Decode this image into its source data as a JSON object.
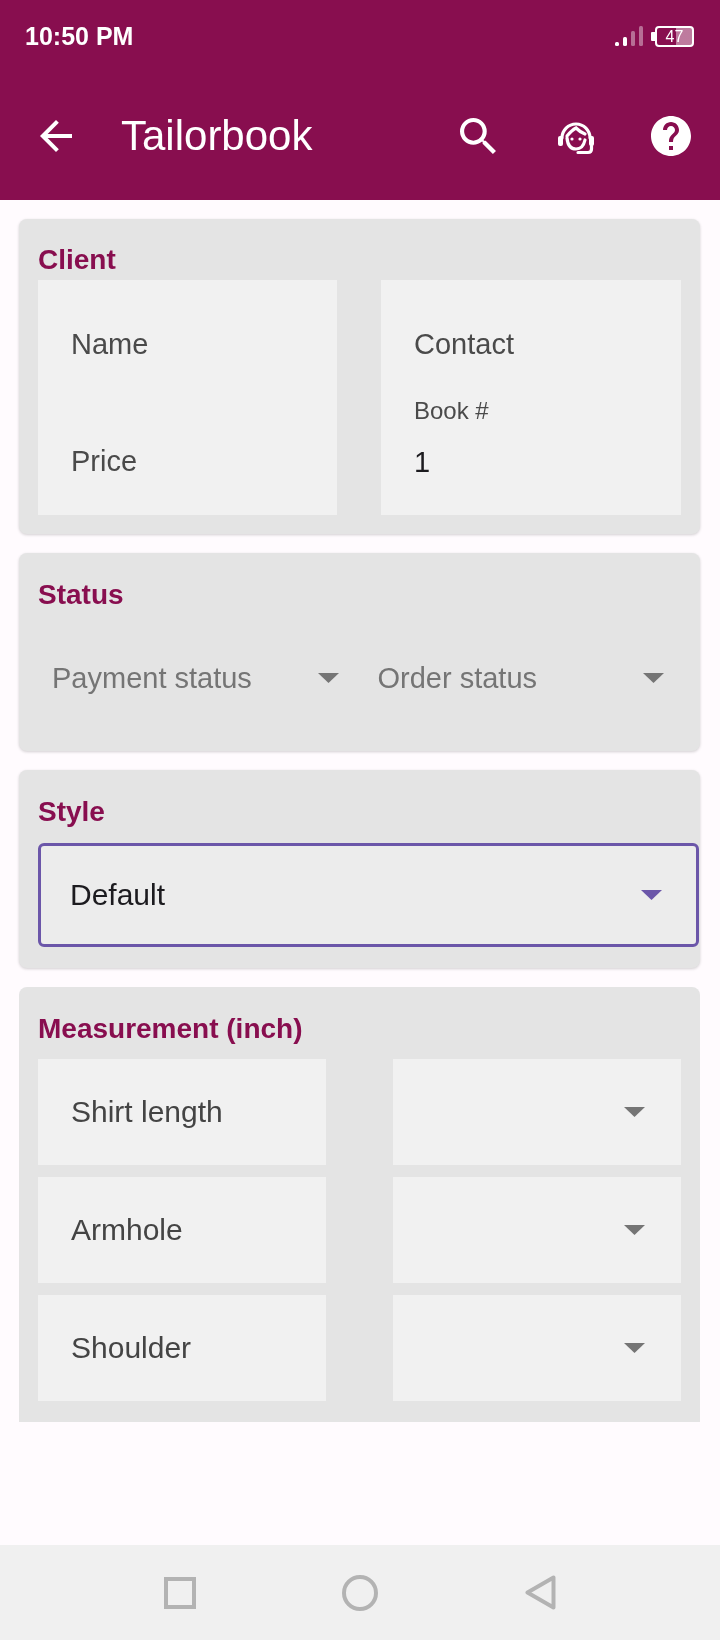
{
  "status_bar": {
    "time": "10:50 PM",
    "battery": "47"
  },
  "app_bar": {
    "title": "Tailorbook"
  },
  "client": {
    "title": "Client",
    "columns": [
      {
        "fields": [
          {
            "placeholder": "Name"
          },
          {
            "placeholder": "Price"
          }
        ]
      },
      {
        "fields": [
          {
            "placeholder": "Contact"
          },
          {
            "label": "Book #",
            "value": "1"
          }
        ]
      }
    ]
  },
  "status": {
    "title": "Status",
    "dropdowns": [
      {
        "placeholder": "Payment status"
      },
      {
        "placeholder": "Order status"
      }
    ]
  },
  "style": {
    "title": "Style",
    "dropdown": {
      "value": "Default",
      "focused": true
    }
  },
  "measurement": {
    "title": "Measurement (inch)",
    "rows": [
      {
        "label": "Shirt length"
      },
      {
        "label": "Armhole"
      },
      {
        "label": "Shoulder"
      }
    ]
  }
}
